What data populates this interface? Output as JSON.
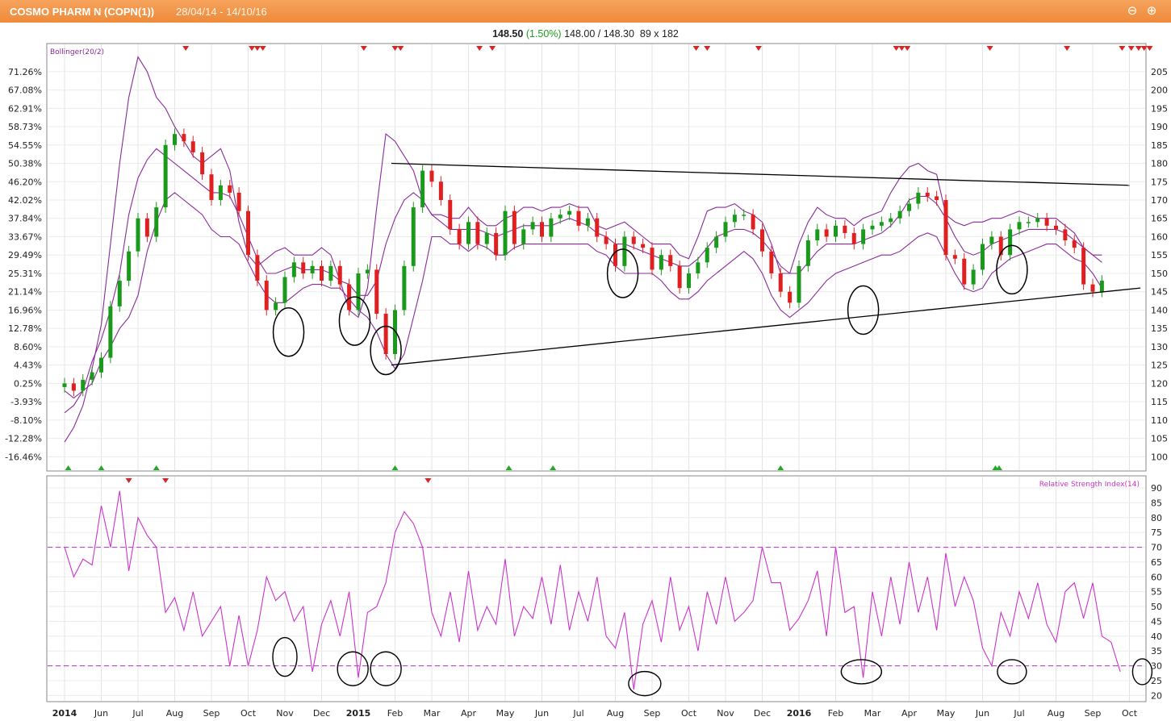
{
  "header": {
    "title": "COSMO PHARM N (COPN(1))",
    "date_range": "28/04/14 - 14/10/16",
    "zoom_out_icon": "zoom-out-icon",
    "zoom_in_icon": "zoom-in-icon"
  },
  "quote": {
    "last": "148.50",
    "change": "(1.50%)",
    "bid_ask": "148.00 / 148.30",
    "size": "89 x 182"
  },
  "colors": {
    "title_bar": "#ef8c3c",
    "up_candle": "#1a9a1a",
    "down_candle": "#e02020",
    "bollinger": "#8a2a9a",
    "rsi": "#cc33cc",
    "trendline": "#000000"
  },
  "chart_data": [
    {
      "type": "line",
      "name": "price",
      "indicator_label": "Bollinger(20/2)",
      "x_labels": [
        "2014",
        "Jun",
        "Jul",
        "Aug",
        "Sep",
        "Oct",
        "Nov",
        "Dec",
        "2015",
        "Feb",
        "Mar",
        "Apr",
        "May",
        "Jun",
        "Jul",
        "Aug",
        "Sep",
        "Oct",
        "Nov",
        "Dec",
        "2016",
        "Feb",
        "Mar",
        "Apr",
        "May",
        "Jun",
        "Jul",
        "Aug",
        "Sep",
        "Oct"
      ],
      "y_right_ticks": [
        100,
        105,
        110,
        115,
        120,
        125,
        130,
        135,
        140,
        145,
        150,
        155,
        160,
        165,
        170,
        175,
        180,
        185,
        190,
        195,
        200,
        205
      ],
      "y_left_ticks": [
        "71.26%",
        "67.08%",
        "62.91%",
        "58.73%",
        "54.55%",
        "50.38%",
        "46.20%",
        "42.02%",
        "37.84%",
        "33.67%",
        "29.49%",
        "25.31%",
        "21.14%",
        "16.96%",
        "12.78%",
        "8.60%",
        "4.43%",
        "0.25%",
        "-3.93%",
        "-8.10%",
        "-12.28%",
        "-16.46%"
      ],
      "ylim": [
        97,
        212
      ],
      "x": [
        0,
        0.25,
        0.5,
        0.75,
        1,
        1.25,
        1.5,
        1.75,
        2,
        2.25,
        2.5,
        2.75,
        3,
        3.25,
        3.5,
        3.75,
        4,
        4.25,
        4.5,
        4.75,
        5,
        5.25,
        5.5,
        5.75,
        6,
        6.25,
        6.5,
        6.75,
        7,
        7.25,
        7.5,
        7.75,
        8,
        8.25,
        8.5,
        8.75,
        9,
        9.25,
        9.5,
        9.75,
        10,
        10.25,
        10.5,
        10.75,
        11,
        11.25,
        11.5,
        11.75,
        12,
        12.25,
        12.5,
        12.75,
        13,
        13.25,
        13.5,
        13.75,
        14,
        14.25,
        14.5,
        14.75,
        15,
        15.25,
        15.5,
        15.75,
        16,
        16.25,
        16.5,
        16.75,
        17,
        17.25,
        17.5,
        17.75,
        18,
        18.25,
        18.5,
        18.75,
        19,
        19.25,
        19.5,
        19.75,
        20,
        20.25,
        20.5,
        20.75,
        21,
        21.25,
        21.5,
        21.75,
        22,
        22.25,
        22.5,
        22.75,
        23,
        23.25,
        23.5,
        23.75,
        24,
        24.25,
        24.5,
        24.75,
        25,
        25.25,
        25.5,
        25.75,
        26,
        26.25,
        26.5,
        26.75,
        27,
        27.25,
        27.5,
        27.75,
        28,
        28.25,
        28.5,
        28.75,
        29,
        29.4
      ],
      "values": [
        120,
        118,
        121,
        123,
        127,
        141,
        148,
        156,
        165,
        160,
        168,
        185,
        188,
        186,
        183,
        177,
        170,
        174,
        172,
        167,
        155,
        148,
        140,
        142,
        149,
        153,
        150,
        152,
        148,
        152,
        147,
        140,
        150,
        151,
        139,
        128,
        140,
        152,
        168,
        178,
        175,
        170,
        162,
        158,
        164,
        158,
        161,
        155,
        167,
        158,
        162,
        164,
        160,
        165,
        166,
        167,
        163,
        165,
        160,
        158,
        152,
        160,
        158,
        157,
        151,
        155,
        152,
        146,
        150,
        153,
        157,
        160,
        164,
        166,
        166,
        162,
        156,
        150,
        145,
        142,
        152,
        159,
        162,
        160,
        163,
        161,
        158,
        162,
        163,
        164,
        165,
        167,
        169,
        172,
        171,
        170,
        155,
        154,
        147,
        151,
        158,
        160,
        155,
        162,
        164,
        164,
        165,
        163,
        162,
        159,
        157,
        147,
        145,
        148
      ],
      "series": [
        {
          "name": "upper_band",
          "values": [
            104,
            108,
            114,
            124,
            136,
            158,
            180,
            198,
            209,
            205,
            198,
            195,
            190,
            186,
            182,
            180,
            182,
            184,
            178,
            164,
            155,
            152,
            154,
            156,
            157,
            155,
            155,
            155,
            157,
            155,
            148,
            140,
            138,
            146,
            168,
            188,
            186,
            182,
            178,
            170,
            166,
            166,
            165,
            165,
            168,
            165,
            163,
            163,
            165,
            166,
            168,
            168,
            167,
            168,
            168,
            169,
            168,
            168,
            163,
            162,
            163,
            164,
            162,
            160,
            158,
            158,
            158,
            155,
            154,
            160,
            167,
            168,
            168,
            169,
            167,
            166,
            164,
            158,
            150,
            150,
            158,
            164,
            168,
            166,
            165,
            165,
            163,
            165,
            166,
            167,
            172,
            176,
            179,
            180,
            178,
            177,
            166,
            164,
            163,
            164,
            164,
            165,
            165,
            166,
            167,
            166,
            165,
            165,
            165,
            163,
            161,
            157,
            155,
            155
          ]
        },
        {
          "name": "middle_band",
          "values": [
            112,
            114,
            118,
            126,
            132,
            140,
            150,
            166,
            176,
            181,
            184,
            182,
            180,
            178,
            176,
            174,
            172,
            172,
            171,
            166,
            160,
            154,
            150,
            150,
            151,
            152,
            151,
            151,
            151,
            150,
            148,
            147,
            144,
            144,
            148,
            158,
            165,
            170,
            172,
            170,
            166,
            164,
            162,
            162,
            162,
            162,
            161,
            160,
            161,
            162,
            163,
            163,
            163,
            163,
            164,
            165,
            164,
            163,
            161,
            160,
            158,
            158,
            157,
            156,
            155,
            154,
            153,
            152,
            152,
            154,
            157,
            160,
            161,
            162,
            162,
            161,
            159,
            156,
            152,
            150,
            150,
            153,
            156,
            158,
            158,
            158,
            158,
            159,
            160,
            161,
            163,
            166,
            170,
            171,
            171,
            169,
            165,
            160,
            156,
            155,
            156,
            158,
            159,
            160,
            161,
            162,
            162,
            162,
            162,
            161,
            159,
            157,
            155,
            153
          ]
        },
        {
          "name": "lower_band",
          "values": [
            118,
            116,
            118,
            120,
            126,
            130,
            135,
            138,
            144,
            156,
            164,
            170,
            172,
            170,
            168,
            166,
            162,
            160,
            160,
            158,
            153,
            148,
            144,
            142,
            142,
            144,
            146,
            147,
            147,
            146,
            146,
            143,
            140,
            138,
            134,
            128,
            124,
            128,
            138,
            148,
            160,
            160,
            158,
            158,
            156,
            158,
            157,
            155,
            155,
            157,
            158,
            158,
            158,
            158,
            158,
            158,
            158,
            158,
            156,
            155,
            152,
            150,
            150,
            150,
            150,
            148,
            145,
            143,
            143,
            145,
            148,
            150,
            152,
            154,
            156,
            154,
            150,
            144,
            140,
            138,
            140,
            142,
            145,
            148,
            150,
            151,
            152,
            153,
            154,
            155,
            155,
            156,
            158,
            160,
            161,
            160,
            155,
            150,
            146,
            145,
            146,
            150,
            152,
            154,
            155,
            156,
            157,
            158,
            158,
            156,
            154,
            153,
            150,
            146
          ]
        }
      ],
      "trendlines": [
        {
          "x": [
            8.9,
            29.0
          ],
          "values": [
            180,
            174
          ]
        },
        {
          "x": [
            8.9,
            29.3
          ],
          "values": [
            125,
            146
          ]
        }
      ],
      "sell_marker_x": [
        3.3,
        5.1,
        5.25,
        5.4,
        8.15,
        9.0,
        9.15,
        11.3,
        11.65,
        17.2,
        17.5,
        18.9,
        22.65,
        22.8,
        22.95,
        25.2,
        27.3,
        28.8,
        29.05,
        29.25,
        29.4,
        29.55
      ],
      "buy_marker_x": [
        0.1,
        1.0,
        2.5,
        9.0,
        12.1,
        13.3,
        19.5,
        25.35,
        25.45
      ],
      "circled_lows": [
        {
          "x": 6.1,
          "value": 134
        },
        {
          "x": 7.9,
          "value": 137
        },
        {
          "x": 8.75,
          "value": 129
        },
        {
          "x": 15.2,
          "value": 150
        },
        {
          "x": 21.75,
          "value": 140
        },
        {
          "x": 25.8,
          "value": 151
        }
      ]
    },
    {
      "type": "line",
      "name": "rsi",
      "title": "Relative Strength Index(14)",
      "y_ticks": [
        20,
        25,
        30,
        35,
        40,
        45,
        50,
        55,
        60,
        65,
        70,
        75,
        80,
        85,
        90
      ],
      "ylim": [
        19,
        93
      ],
      "reference_lines": [
        30,
        70
      ],
      "x": [
        0,
        0.25,
        0.5,
        0.75,
        1,
        1.25,
        1.5,
        1.75,
        2,
        2.25,
        2.5,
        2.75,
        3,
        3.25,
        3.5,
        3.75,
        4,
        4.25,
        4.5,
        4.75,
        5,
        5.25,
        5.5,
        5.75,
        6,
        6.25,
        6.5,
        6.75,
        7,
        7.25,
        7.5,
        7.75,
        8,
        8.25,
        8.5,
        8.75,
        9,
        9.25,
        9.5,
        9.75,
        10,
        10.25,
        10.5,
        10.75,
        11,
        11.25,
        11.5,
        11.75,
        12,
        12.25,
        12.5,
        12.75,
        13,
        13.25,
        13.5,
        13.75,
        14,
        14.25,
        14.5,
        14.75,
        15,
        15.25,
        15.5,
        15.75,
        16,
        16.25,
        16.5,
        16.75,
        17,
        17.25,
        17.5,
        17.75,
        18,
        18.25,
        18.5,
        18.75,
        19,
        19.25,
        19.5,
        19.75,
        20,
        20.25,
        20.5,
        20.75,
        21,
        21.25,
        21.5,
        21.75,
        22,
        22.25,
        22.5,
        22.75,
        23,
        23.25,
        23.5,
        23.75,
        24,
        24.25,
        24.5,
        24.75,
        25,
        25.25,
        25.5,
        25.75,
        26,
        26.25,
        26.5,
        26.75,
        27,
        27.25,
        27.5,
        27.75,
        28,
        28.25,
        28.5,
        28.75,
        29,
        29.4
      ],
      "values": [
        70,
        60,
        66,
        64,
        84,
        70,
        89,
        62,
        80,
        74,
        70,
        48,
        53,
        42,
        55,
        40,
        45,
        50,
        30,
        47,
        30,
        42,
        60,
        52,
        55,
        45,
        50,
        28,
        44,
        52,
        40,
        55,
        26,
        48,
        50,
        58,
        75,
        82,
        78,
        70,
        48,
        40,
        55,
        38,
        62,
        42,
        50,
        44,
        66,
        40,
        50,
        46,
        60,
        44,
        64,
        42,
        55,
        45,
        60,
        40,
        36,
        48,
        22,
        44,
        52,
        38,
        60,
        42,
        50,
        35,
        55,
        44,
        60,
        45,
        48,
        52,
        70,
        58,
        58,
        42,
        46,
        52,
        62,
        40,
        70,
        48,
        50,
        26,
        55,
        40,
        60,
        44,
        65,
        48,
        60,
        42,
        68,
        50,
        60,
        52,
        36,
        30,
        48,
        40,
        55,
        46,
        58,
        44,
        38,
        55,
        58,
        46,
        58,
        40,
        38,
        28
      ]
    }
  ],
  "x_axis_labels": [
    "2014",
    "Jun",
    "Jul",
    "Aug",
    "Sep",
    "Oct",
    "Nov",
    "Dec",
    "2015",
    "Feb",
    "Mar",
    "Apr",
    "May",
    "Jun",
    "Jul",
    "Aug",
    "Sep",
    "Oct",
    "Nov",
    "Dec",
    "2016",
    "Feb",
    "Mar",
    "Apr",
    "May",
    "Jun",
    "Jul",
    "Aug",
    "Sep",
    "Oct"
  ]
}
